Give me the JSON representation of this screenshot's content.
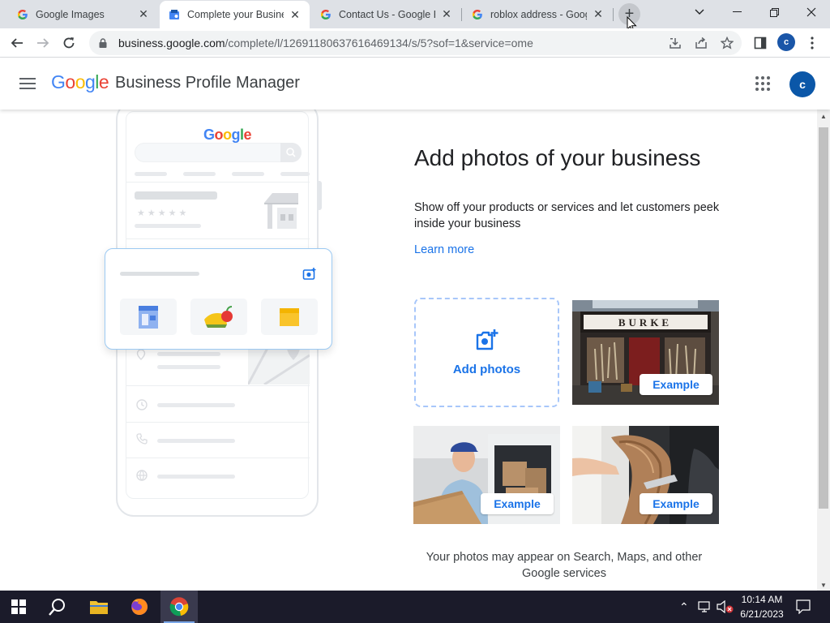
{
  "browser": {
    "tabs": [
      {
        "title": "Google Images",
        "favicon": "google-g-icon",
        "active": false
      },
      {
        "title": "Complete your Business",
        "favicon": "business-profile-icon",
        "active": true
      },
      {
        "title": "Contact Us - Google Bu",
        "favicon": "google-g-icon",
        "active": false
      },
      {
        "title": "roblox address - Goog",
        "favicon": "google-g-icon",
        "active": false
      }
    ],
    "url_host": "business.google.com",
    "url_path": "/complete/l/12691180637616469134/s/5?sof=1&service=ome",
    "profile_initial": "c"
  },
  "header": {
    "logo": {
      "l1": "G",
      "l2": "o",
      "l3": "o",
      "l4": "g",
      "l5": "l",
      "l6": "e"
    },
    "product": "Business Profile Manager",
    "avatar_initial": "c"
  },
  "illustration": {
    "phone_logo": "Google"
  },
  "main": {
    "title": "Add photos of your business",
    "description": "Show off your products or services and let customers peek inside your business",
    "learn_more": "Learn more",
    "add_photos_label": "Add photos",
    "examples": [
      {
        "label": "Example",
        "sign": "BURKE"
      },
      {
        "label": "Example"
      },
      {
        "label": "Example"
      }
    ],
    "footer_note": "Your photos may appear on Search, Maps, and other Google services"
  },
  "taskbar": {
    "time": "10:14 AM",
    "date": "6/21/2023"
  },
  "colors": {
    "accent": "#1a73e8",
    "avatar": "#0b57a8"
  }
}
